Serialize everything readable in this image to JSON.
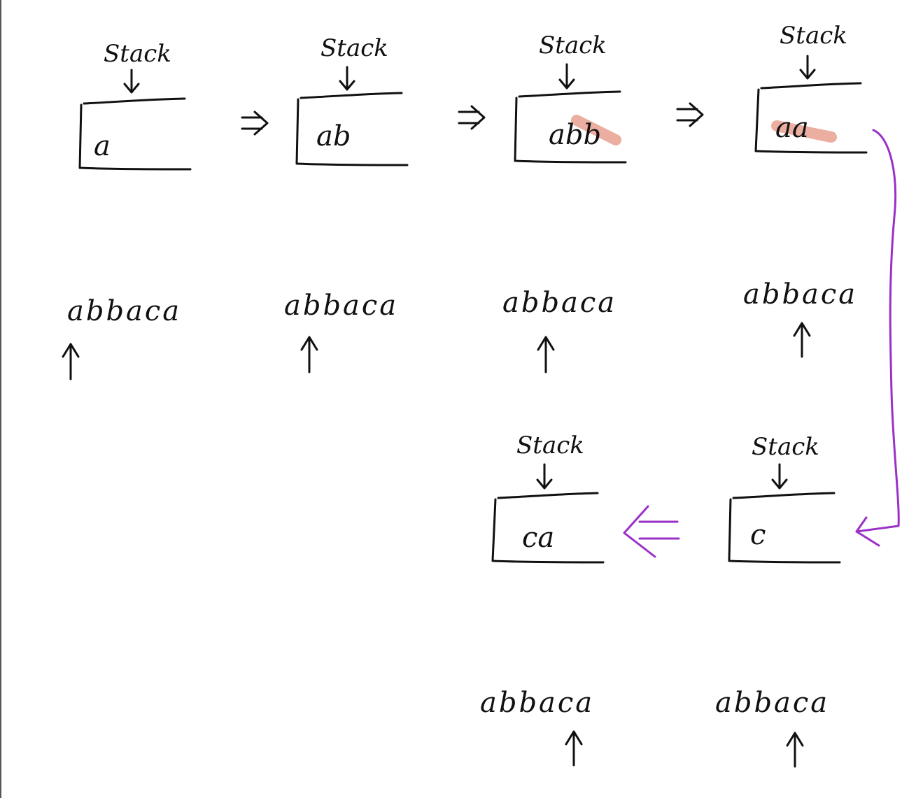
{
  "stack_label": "Stack",
  "input_string": "abbaca",
  "steps": [
    {
      "id": "step-1",
      "contents": "a"
    },
    {
      "id": "step-2",
      "contents": "ab"
    },
    {
      "id": "step-3",
      "contents": "abb"
    },
    {
      "id": "step-4",
      "contents": "aa"
    },
    {
      "id": "step-5",
      "contents": "c"
    },
    {
      "id": "step-6",
      "contents": "ca"
    }
  ],
  "colors": {
    "ink": "#111111",
    "highlight": "#e9a597",
    "arrow_purple": "#9b30c8"
  }
}
